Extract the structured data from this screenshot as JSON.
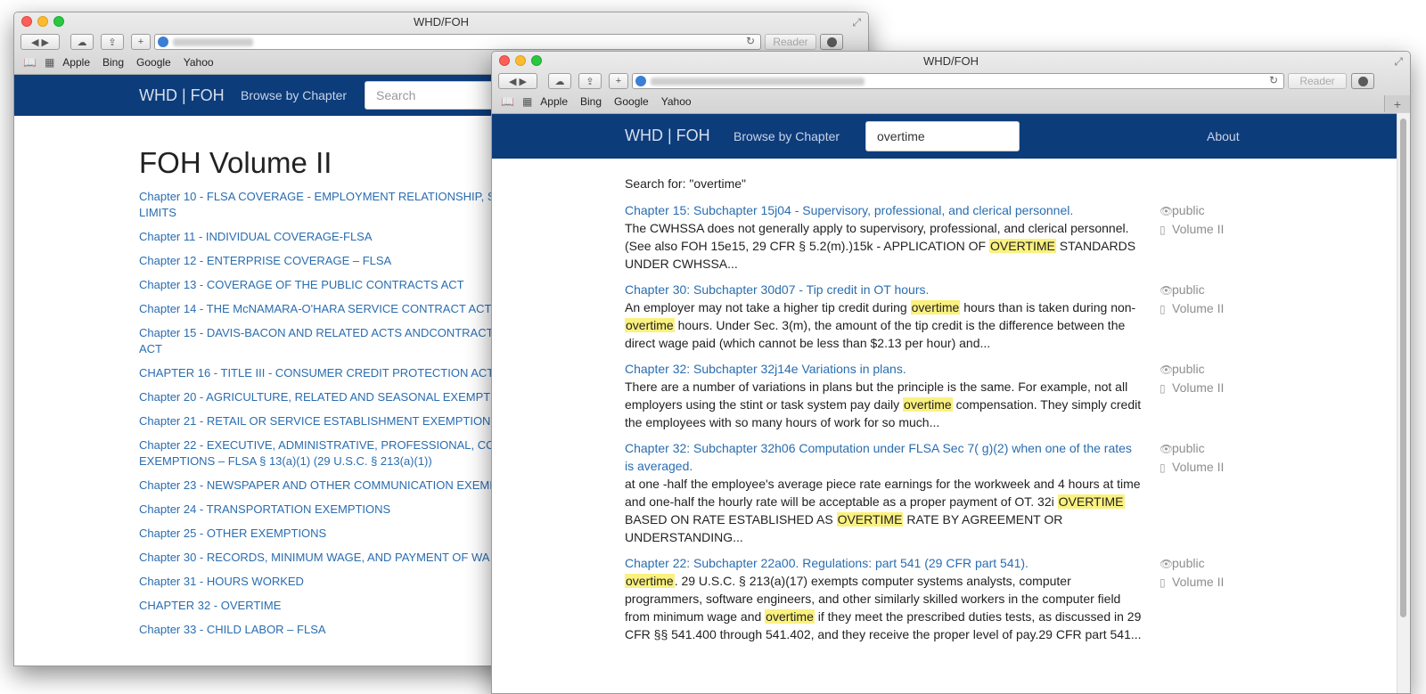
{
  "browser": {
    "window_title": "WHD/FOH",
    "reader_label": "Reader",
    "bookmarks": [
      "Apple",
      "Bing",
      "Google",
      "Yahoo"
    ]
  },
  "back_window": {
    "nav": {
      "brand": "WHD | FOH",
      "browse": "Browse by Chapter",
      "search_placeholder": "Search"
    },
    "page_title": "FOH Volume II",
    "chapters": [
      "Chapter 10 - FLSA COVERAGE - EMPLOYMENT RELATIONSHIP, S\nLIMITS",
      "Chapter 11 - INDIVIDUAL COVERAGE-FLSA",
      "Chapter 12 - ENTERPRISE COVERAGE – FLSA",
      "Chapter 13 - COVERAGE OF THE PUBLIC CONTRACTS ACT",
      "Chapter 14 - THE McNAMARA-O'HARA SERVICE CONTRACT ACT",
      "Chapter 15 - DAVIS-BACON AND RELATED ACTS ANDCONTRACT\nACT",
      "CHAPTER 16 - TITLE III - CONSUMER CREDIT PROTECTION ACT",
      "Chapter 20 - AGRICULTURE, RELATED AND SEASONAL EXEMPTI",
      "Chapter 21 - RETAIL OR SERVICE ESTABLISHMENT EXEMPTIONS",
      "Chapter 22 - EXECUTIVE, ADMINISTRATIVE, PROFESSIONAL, CO\nEXEMPTIONS – FLSA § 13(a)(1) (29 U.S.C. § 213(a)(1))",
      "Chapter 23 - NEWSPAPER AND OTHER COMMUNICATION EXEMI",
      "Chapter 24 - TRANSPORTATION EXEMPTIONS",
      "Chapter 25 - OTHER EXEMPTIONS",
      "Chapter 30 - RECORDS, MINIMUM WAGE, AND PAYMENT OF WA",
      "Chapter 31 - HOURS WORKED",
      "CHAPTER 32 - OVERTIME",
      "Chapter 33 - CHILD LABOR – FLSA"
    ]
  },
  "front_window": {
    "nav": {
      "brand": "WHD | FOH",
      "browse": "Browse by Chapter",
      "search_value": "overtime",
      "about": "About"
    },
    "search_for": "Search for: \"overtime\"",
    "results": [
      {
        "title": "Chapter 15: Subchapter 15j04 - Supervisory, professional, and clerical personnel.",
        "snippet": [
          {
            "t": "The CWHSSA does not generally apply to supervisory, professional, and clerical personnel. (See also FOH 15e15, 29 CFR § 5.2(m).)15k - APPLICATION OF "
          },
          {
            "h": "OVERTIME"
          },
          {
            "t": " STANDARDS UNDER CWHSSA..."
          }
        ],
        "visibility": "public",
        "volume": "Volume II"
      },
      {
        "title": "Chapter 30: Subchapter 30d07 - Tip credit in OT hours.",
        "snippet": [
          {
            "t": "An employer may not take a higher tip credit during "
          },
          {
            "h": "overtime"
          },
          {
            "t": " hours than is taken during non-"
          },
          {
            "h": "overtime"
          },
          {
            "t": " hours. Under Sec. 3(m), the amount of the tip credit is the difference between the direct wage paid (which cannot be less than $2.13 per hour) and..."
          }
        ],
        "visibility": "public",
        "volume": "Volume II"
      },
      {
        "title": "Chapter 32: Subchapter 32j14e Variations in plans.",
        "snippet": [
          {
            "t": "There are a number of variations in plans but the principle is the same. For example, not all employers using the stint or task system pay daily "
          },
          {
            "h": "overtime"
          },
          {
            "t": " compensation. They simply credit the employees with so many hours of work for so much..."
          }
        ],
        "visibility": "public",
        "volume": "Volume II"
      },
      {
        "title": "Chapter 32: Subchapter 32h06 Computation under FLSA Sec 7( g)(2) when one of the rates is averaged.",
        "snippet": [
          {
            "t": "at one -half the employee's average piece rate earnings for the workweek and 4 hours at time and one-half the hourly rate will be acceptable as a proper payment of OT. 32i "
          },
          {
            "h": "OVERTIME"
          },
          {
            "t": " BASED ON RATE ESTABLISHED AS "
          },
          {
            "h": "OVERTIME"
          },
          {
            "t": " RATE BY AGREEMENT OR UNDERSTANDING..."
          }
        ],
        "visibility": "public",
        "volume": "Volume II"
      },
      {
        "title": "Chapter 22: Subchapter 22a00. Regulations: part 541 (29 CFR part 541).",
        "snippet": [
          {
            "h": "overtime"
          },
          {
            "t": ". 29 U.S.C. § 213(a)(17) exempts computer systems analysts, computer programmers, software engineers, and other similarly skilled workers in the computer field from minimum wage and "
          },
          {
            "h": "overtime"
          },
          {
            "t": " if they meet the prescribed duties tests, as discussed in 29 CFR §§ 541.400 through 541.402, and they receive the proper level of pay.29 CFR part 541..."
          }
        ],
        "visibility": "public",
        "volume": "Volume II"
      }
    ]
  },
  "icons": {
    "eye": "eye-icon",
    "document": "document-icon",
    "globe": "globe-icon",
    "reload": "reload-icon"
  },
  "colors": {
    "navbar": "#0d3c7b",
    "link": "#2a6db0",
    "highlight": "#fbf17f"
  }
}
